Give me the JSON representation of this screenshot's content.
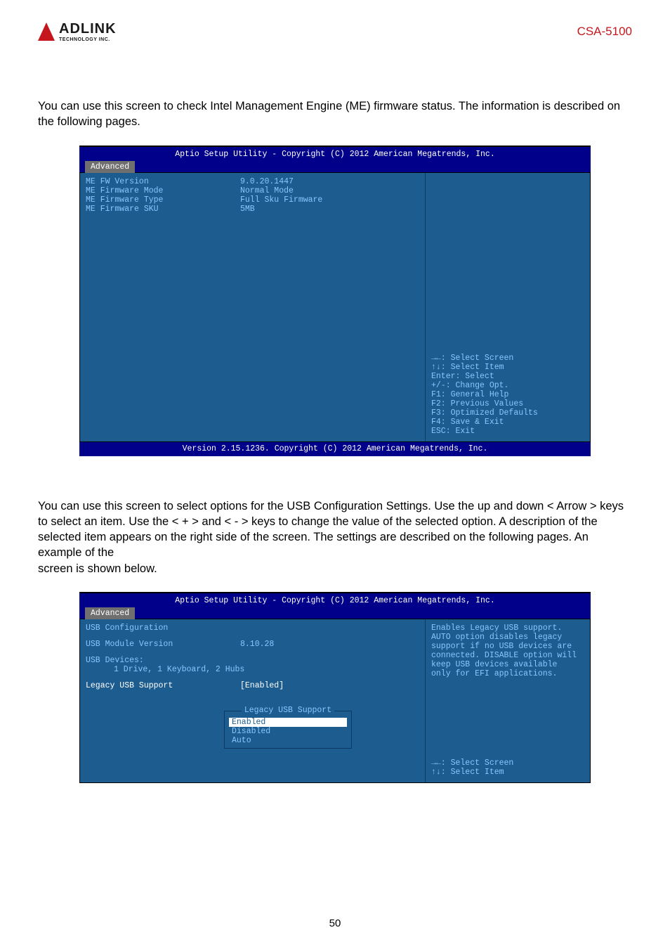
{
  "header": {
    "logo_main": "ADLINK",
    "logo_sub": "TECHNOLOGY INC.",
    "doc_id": "CSA-5100"
  },
  "para1": "You can use this screen to check Intel Management Engine (ME) firmware status. The information is described on the following pages.",
  "bios1": {
    "title": "Aptio Setup Utility - Copyright (C) 2012 American Megatrends, Inc.",
    "tab": "Advanced",
    "rows": [
      {
        "label": "ME FW Version",
        "value": "9.0.20.1447"
      },
      {
        "label": "ME Firmware Mode",
        "value": "Normal Mode"
      },
      {
        "label": "ME Firmware Type",
        "value": "Full Sku Firmware"
      },
      {
        "label": "ME Firmware SKU",
        "value": "5MB"
      }
    ],
    "help": [
      "→←: Select Screen",
      "↑↓: Select Item",
      "Enter: Select",
      "+/-: Change Opt.",
      "F1: General Help",
      "F2: Previous Values",
      "F3: Optimized Defaults",
      "F4: Save & Exit",
      "ESC: Exit"
    ],
    "footer": "Version 2.15.1236. Copyright (C) 2012 American Megatrends, Inc."
  },
  "para2": "You can use this screen to select options for the USB Configuration Settings. Use the up and down < Arrow > keys to select an item. Use the < + > and < - > keys to change the value of the selected option. A description of the selected item appears on the right side of the screen. The settings are described on the following pages. An example of the",
  "para2b": "screen is shown below.",
  "bios2": {
    "title": "Aptio Setup Utility - Copyright (C) 2012 American Megatrends, Inc.",
    "tab": "Advanced",
    "section_title": "USB Configuration",
    "module_label": "USB Module Version",
    "module_value": "8.10.28",
    "devices_label": "USB Devices:",
    "devices_value": "1 Drive, 1 Keyboard, 2 Hubs",
    "legacy_label": "Legacy USB Support",
    "legacy_value": "[Enabled]",
    "desc": [
      "Enables Legacy USB support.",
      "AUTO option disables legacy",
      "support if no USB devices are",
      "connected. DISABLE option will",
      "keep USB devices available",
      "only for EFI applications."
    ],
    "popup_title": "Legacy USB Support",
    "popup_items": [
      "Enabled",
      "Disabled",
      "Auto"
    ],
    "help_partial": [
      "→←: Select Screen",
      "↑↓: Select Item"
    ]
  },
  "page_number": "50"
}
